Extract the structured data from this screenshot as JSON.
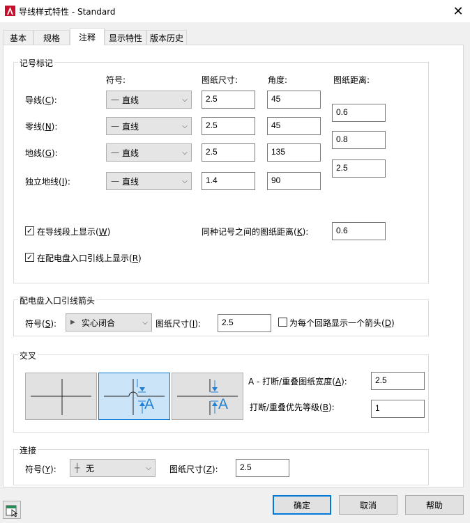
{
  "window": {
    "title": "导线样式特性 - Standard",
    "app_icon": "autocad-a-icon",
    "close_glyph": "✕"
  },
  "tabs": [
    {
      "label": "基本",
      "active": false
    },
    {
      "label": "规格",
      "active": false
    },
    {
      "label": "注释",
      "active": true
    },
    {
      "label": "显示特性",
      "active": false
    },
    {
      "label": "版本历史",
      "active": false
    }
  ],
  "symbol_marks": {
    "title": "记号标记",
    "headers": {
      "symbol": "符号:",
      "paper_size": "图纸尺寸:",
      "angle": "角度:",
      "paper_distance": "图纸距离:"
    },
    "rows": [
      {
        "label": "导线(",
        "key": "C",
        "label_end": "):",
        "symbol": "直线",
        "size": "2.5",
        "angle": "45"
      },
      {
        "label": "零线(",
        "key": "N",
        "label_end": "):",
        "symbol": "直线",
        "size": "2.5",
        "angle": "45"
      },
      {
        "label": "地线(",
        "key": "G",
        "label_end": "):",
        "symbol": "直线",
        "size": "2.5",
        "angle": "135"
      },
      {
        "label": "独立地线(",
        "key": "I",
        "label_end": "):",
        "symbol": "直线",
        "size": "1.4",
        "angle": "90"
      }
    ],
    "distances": [
      "0.6",
      "0.8",
      "2.5"
    ],
    "show_on_wire": {
      "checked": true,
      "label": "在导线段上显示(",
      "key": "W",
      "label_end": ")"
    },
    "show_on_home_run": {
      "checked": true,
      "label": "在配电盘入口引线上显示(",
      "key": "R",
      "label_end": ")"
    },
    "same_mark_distance": {
      "label": "同种记号之间的图纸距离(",
      "key": "K",
      "label_end": "):",
      "value": "0.6"
    }
  },
  "home_run_arrow": {
    "title": "配电盘入口引线箭头",
    "symbol_label": "符号(",
    "symbol_key": "S",
    "symbol_label_end": "):",
    "symbol_value": "实心闭合",
    "size_label": "图纸尺寸(",
    "size_key": "I",
    "size_label_end": "):",
    "size_value": "2.5",
    "per_circuit": {
      "checked": false,
      "label": "为每个回路显示一个箭头(",
      "key": "D",
      "label_end": ")"
    }
  },
  "crossing": {
    "title": "交叉",
    "styles": [
      "plain-cross",
      "hop-gap",
      "break-gap"
    ],
    "selected_index": 1,
    "gap_label": "A - 打断/重叠图纸宽度(",
    "gap_key": "A",
    "gap_label_end": "):",
    "gap_value": "2.5",
    "priority_label": "打断/重叠优先等级(",
    "priority_key": "B",
    "priority_label_end": "):",
    "priority_value": "1",
    "tile_letter": "A"
  },
  "connection": {
    "title": "连接",
    "symbol_label": "符号(",
    "symbol_key": "Y",
    "symbol_label_end": "):",
    "symbol_value": "无",
    "size_label": "图纸尺寸(",
    "size_key": "Z",
    "size_label_end": "):",
    "size_value": "2.5"
  },
  "buttons": {
    "ok": "确定",
    "cancel": "取消",
    "help": "帮助"
  },
  "colors": {
    "accent": "#0078d7",
    "tile_selected": "#cce4f7",
    "icon_red": "#c8102e",
    "marker_blue": "#1f7fd4"
  }
}
